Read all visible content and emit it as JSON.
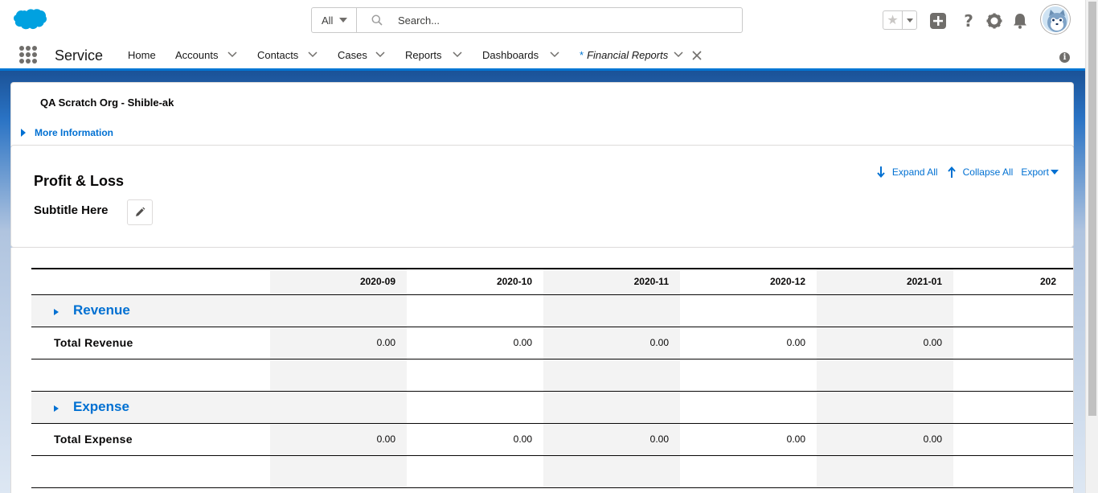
{
  "header": {
    "search_scope": "All",
    "search_placeholder": "Search...",
    "icons": [
      "favorites-star-icon",
      "global-actions-plus-icon",
      "help-icon",
      "setup-gear-icon",
      "notifications-bell-icon",
      "user-avatar"
    ]
  },
  "nav": {
    "app_name": "Service",
    "items": [
      {
        "label": "Home"
      },
      {
        "label": "Accounts"
      },
      {
        "label": "Contacts"
      },
      {
        "label": "Cases"
      },
      {
        "label": "Reports"
      },
      {
        "label": "Dashboards"
      }
    ],
    "active_tab": {
      "prefix": "*",
      "label": "Financial Reports"
    }
  },
  "org": {
    "title": "QA Scratch Org - Shible-ak",
    "more_info": "More Information"
  },
  "report": {
    "title": "Profit & Loss",
    "subtitle": "Subtitle Here",
    "actions": {
      "expand_all": "Expand All",
      "collapse_all": "Collapse All",
      "export": "Export"
    },
    "columns": [
      "2020-09",
      "2020-10",
      "2020-11",
      "2020-12",
      "2021-01",
      "202"
    ],
    "rows": [
      {
        "type": "section",
        "label": "Revenue"
      },
      {
        "type": "total",
        "label": "Total Revenue",
        "values": [
          "0.00",
          "0.00",
          "0.00",
          "0.00",
          "0.00",
          ""
        ]
      },
      {
        "type": "blank"
      },
      {
        "type": "section",
        "label": "Expense"
      },
      {
        "type": "total",
        "label": "Total Expense",
        "values": [
          "0.00",
          "0.00",
          "0.00",
          "0.00",
          "0.00",
          ""
        ]
      },
      {
        "type": "blank"
      }
    ]
  },
  "colors": {
    "brand_blue": "#0176d3",
    "link_blue": "#0070d2",
    "shaded_column": "#f3f3f3"
  }
}
